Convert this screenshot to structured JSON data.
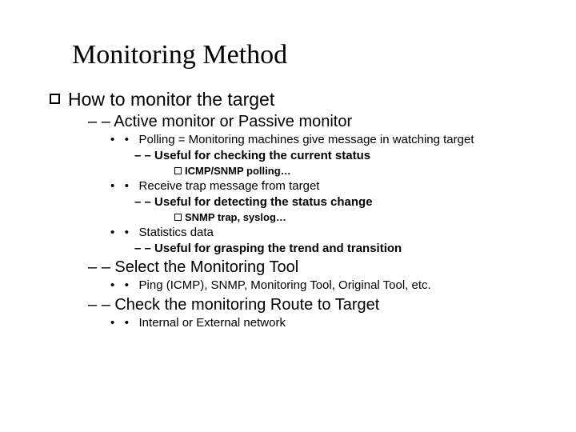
{
  "title": "Monitoring Method",
  "l1": "How to monitor the target",
  "l2a": "Active monitor or Passive monitor",
  "l3a": "Polling = Monitoring machines give message in watching target",
  "l4a": "Useful for checking the current status",
  "l5a": "ICMP/SNMP polling…",
  "l3b": "Receive trap message from target",
  "l4b": "Useful for detecting the status change",
  "l5b": "SNMP trap, syslog…",
  "l3c": "Statistics data",
  "l4c": "Useful for grasping the trend and transition",
  "l2b": "Select the Monitoring Tool",
  "l3d": "Ping (ICMP), SNMP, Monitoring Tool, Original Tool, etc.",
  "l2c": "Check the monitoring Route to Target",
  "l3e": "Internal or External network"
}
